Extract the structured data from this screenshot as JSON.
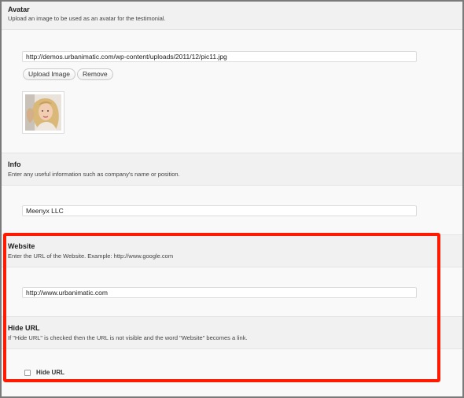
{
  "avatar": {
    "title": "Avatar",
    "description": "Upload an image to be used as an avatar for the testimonial.",
    "url_value": "http://demos.urbanimatic.com/wp-content/uploads/2011/12/pic11.jpg",
    "upload_label": "Upload Image",
    "remove_label": "Remove"
  },
  "info": {
    "title": "Info",
    "description": "Enter any useful information such as company's name or position.",
    "value": "Meenyx LLC"
  },
  "website": {
    "title": "Website",
    "description": "Enter the URL of the Website. Example: http://www.google.com",
    "value": "http://www.urbanimatic.com"
  },
  "hide_url": {
    "title": "Hide URL",
    "description": "If \"Hide URL\" is checked then the URL is not visible and the word \"Website\" becomes a link.",
    "checkbox_label": "Hide URL",
    "checked": false
  },
  "colors": {
    "highlight": "#ff1a00",
    "header_bg": "#f1f1f1",
    "body_bg": "#f9f9f9"
  }
}
